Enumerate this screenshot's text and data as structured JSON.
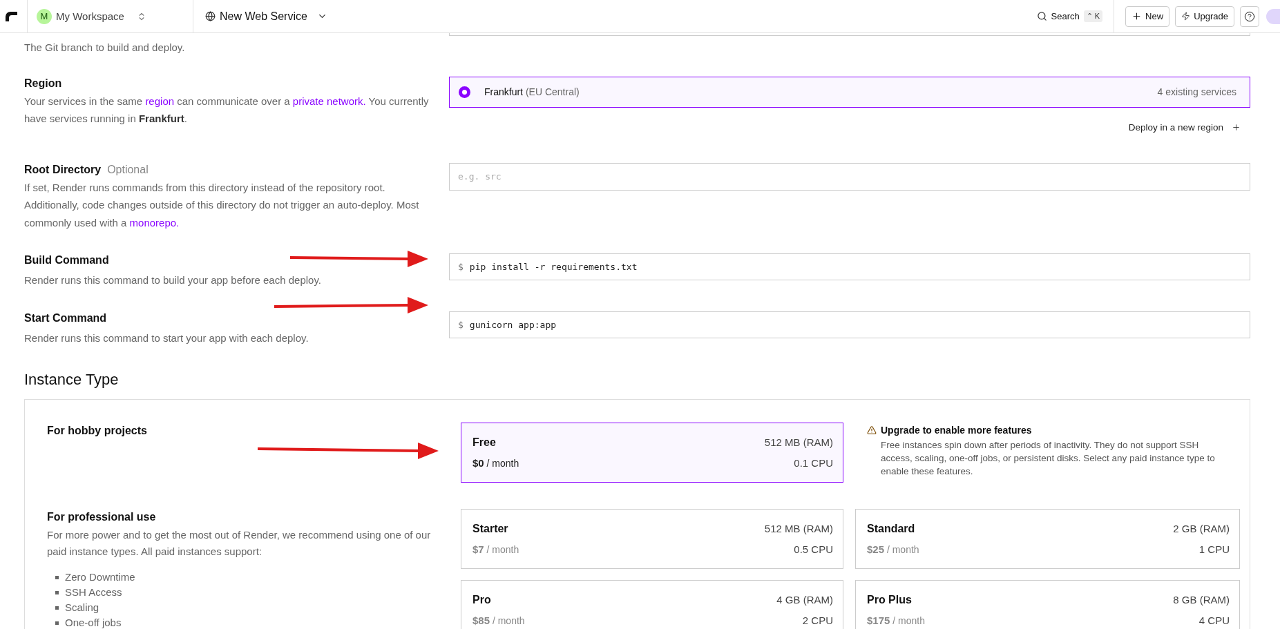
{
  "topbar": {
    "workspace": {
      "initial": "M",
      "name": "My Workspace"
    },
    "service": "New Web Service",
    "search": {
      "label": "Search",
      "shortcut": "⌃ K"
    },
    "buttons": [
      {
        "kind": "new",
        "label": "New"
      },
      {
        "kind": "upgrade",
        "label": "Upgrade"
      },
      {
        "kind": "help"
      }
    ]
  },
  "branch": {
    "description": "The Git branch to build and deploy."
  },
  "region": {
    "title": "Region",
    "description": [
      {
        "kind": "text",
        "text": "Your services in the same "
      },
      {
        "kind": "link",
        "text": "region"
      },
      {
        "kind": "text",
        "text": " can communicate over a "
      },
      {
        "kind": "link",
        "text": "private network."
      },
      {
        "kind": "text",
        "text": " You currently have services running in "
      },
      {
        "kind": "bold",
        "text": "Frankfurt"
      },
      {
        "kind": "text",
        "text": "."
      }
    ],
    "options": [
      {
        "name": "Frankfurt",
        "detail": "(EU Central)",
        "count": "4 existing services",
        "selected": true
      }
    ],
    "deploy_new": "Deploy in a new region"
  },
  "root_directory": {
    "title": "Root Directory",
    "optional": "Optional",
    "description": [
      {
        "kind": "text",
        "text": "If set, Render runs commands from this directory instead of the repository root. Additionally, code changes outside of this directory do not trigger an auto-deploy. Most commonly used with a "
      },
      {
        "kind": "link",
        "text": "monorepo."
      }
    ],
    "placeholder": "e.g. src"
  },
  "commands": [
    {
      "title": "Build Command",
      "description": "Render runs this command to build your app before each deploy.",
      "prompt": "$",
      "value": "pip install -r requirements.txt"
    },
    {
      "title": "Start Command",
      "description": "Render runs this command to start your app with each deploy.",
      "prompt": "$",
      "value": "gunicorn app:app"
    }
  ],
  "instance_type": {
    "heading": "Instance Type",
    "groups": [
      {
        "title": "For hobby projects",
        "plans": [
          {
            "name": "Free",
            "ram": "512 MB (RAM)",
            "price": "$0",
            "period": "/ month",
            "cpu": "0.1 CPU",
            "selected": true
          }
        ],
        "warning": {
          "title": "Upgrade to enable more features",
          "text": "Free instances spin down after periods of inactivity. They do not support SSH access, scaling, one-off jobs, or persistent disks. Select any paid instance type to enable these features."
        }
      },
      {
        "title": "For professional use",
        "description": "For more power and to get the most out of Render, we recommend using one of our paid instance types. All paid instances support:",
        "features": [
          "Zero Downtime",
          "SSH Access",
          "Scaling",
          "One-off jobs"
        ],
        "plans": [
          {
            "name": "Starter",
            "ram": "512 MB (RAM)",
            "price": "$7",
            "period": "/ month",
            "cpu": "0.5 CPU",
            "selected": false
          },
          {
            "name": "Standard",
            "ram": "2 GB (RAM)",
            "price": "$25",
            "period": "/ month",
            "cpu": "1 CPU",
            "selected": false
          },
          {
            "name": "Pro",
            "ram": "4 GB (RAM)",
            "price": "$85",
            "period": "/ month",
            "cpu": "2 CPU",
            "selected": false
          },
          {
            "name": "Pro Plus",
            "ram": "8 GB (RAM)",
            "price": "$175",
            "period": "/ month",
            "cpu": "4 CPU",
            "selected": false
          }
        ]
      }
    ]
  }
}
